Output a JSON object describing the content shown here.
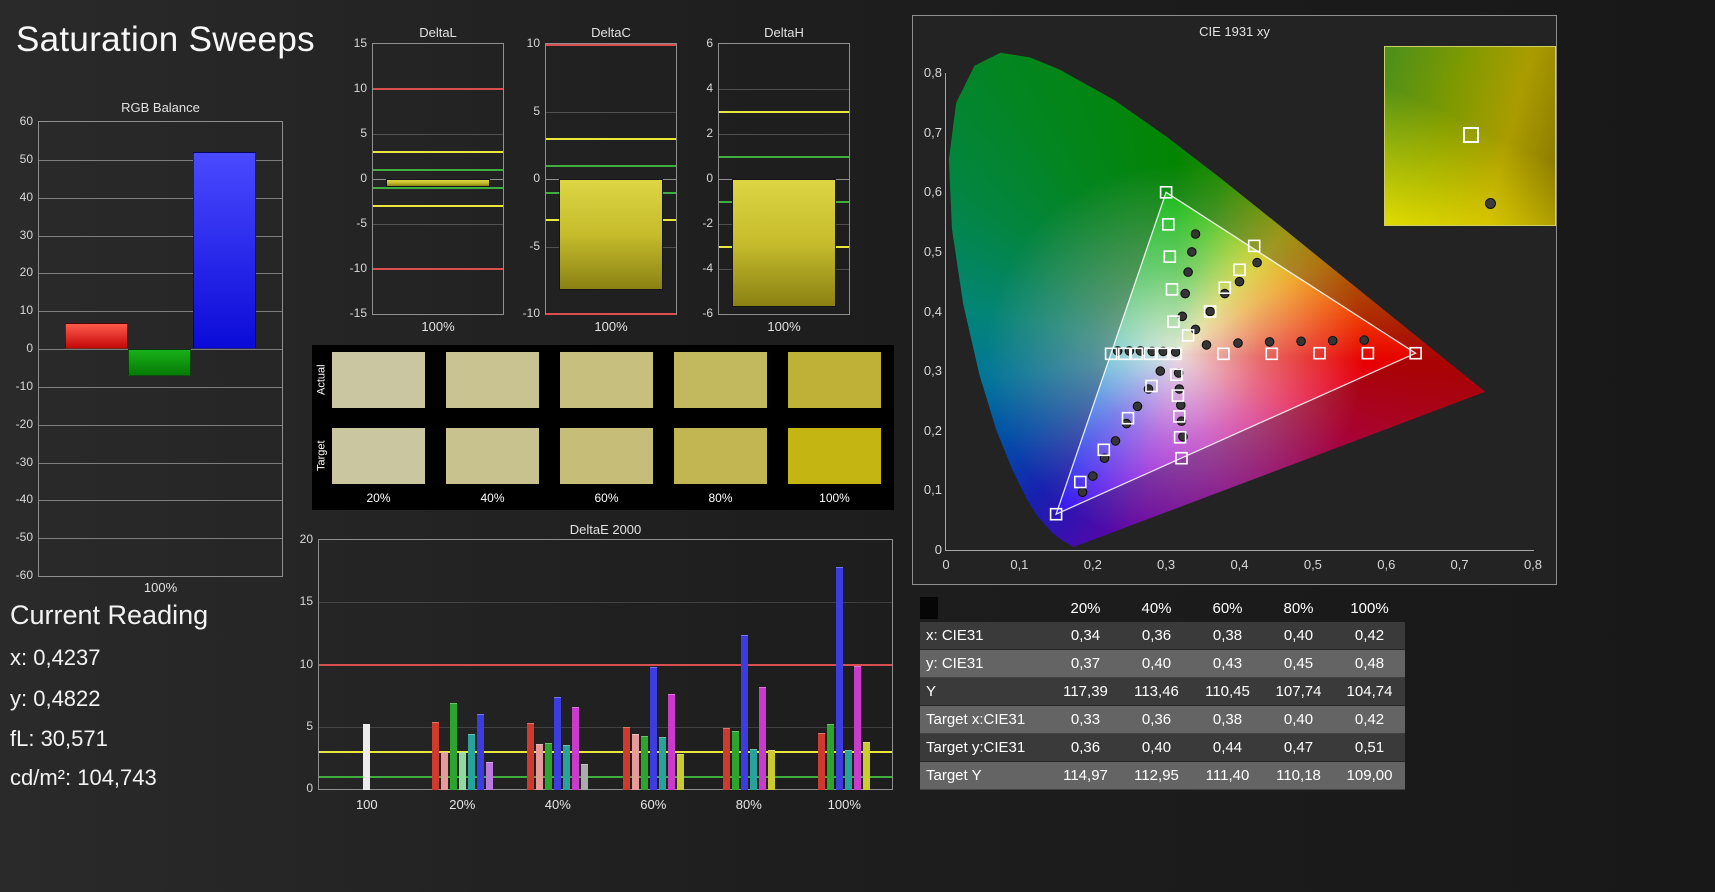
{
  "title": "Saturation Sweeps",
  "current_reading": {
    "heading": "Current Reading",
    "lines": [
      "x: 0,4237",
      "y: 0,4822",
      "fL: 30,571",
      "cd/m²: 104,743"
    ]
  },
  "chart_data": [
    {
      "id": "rgb-balance",
      "type": "bar",
      "title": "RGB Balance",
      "xlabel": "100%",
      "ylim": [
        -60,
        60
      ],
      "ytick_step": 10,
      "categories": [
        "Red",
        "Green",
        "Blue"
      ],
      "values": [
        7,
        -7,
        52
      ],
      "colors": [
        "#e01818",
        "#0f9000",
        "#2222f0"
      ]
    },
    {
      "id": "delta-l",
      "type": "bar",
      "title": "DeltaL",
      "xlabel": "100%",
      "ylim": [
        -15,
        15
      ],
      "yticks": [
        15,
        10,
        5,
        0,
        -5,
        -10,
        -15
      ],
      "categories": [
        "100%"
      ],
      "values": [
        -0.9
      ],
      "bar_color": "#b8c020",
      "ref_lines": [
        {
          "value": 10,
          "color": "#d94f4f"
        },
        {
          "value": -10,
          "color": "#d94f4f"
        },
        {
          "value": 3,
          "color": "#e8e83a"
        },
        {
          "value": -3,
          "color": "#e8e83a"
        },
        {
          "value": 1,
          "color": "#3fae3f"
        },
        {
          "value": -1,
          "color": "#3fae3f"
        }
      ]
    },
    {
      "id": "delta-c",
      "type": "bar",
      "title": "DeltaC",
      "xlabel": "100%",
      "ylim": [
        -10,
        10
      ],
      "yticks": [
        10,
        5,
        0,
        -5,
        -10
      ],
      "categories": [
        "100%"
      ],
      "values": [
        -8.2
      ],
      "bar_color": "#cfc52d",
      "ref_lines": [
        {
          "value": 10,
          "color": "#d94f4f"
        },
        {
          "value": -10,
          "color": "#d94f4f"
        },
        {
          "value": 3,
          "color": "#e8e83a"
        },
        {
          "value": -3,
          "color": "#e8e83a"
        },
        {
          "value": 1,
          "color": "#3fae3f"
        },
        {
          "value": -1,
          "color": "#3fae3f"
        }
      ]
    },
    {
      "id": "delta-h",
      "type": "bar",
      "title": "DeltaH",
      "xlabel": "100%",
      "ylim": [
        -6,
        6
      ],
      "yticks": [
        6,
        4,
        2,
        0,
        -2,
        -4,
        -6
      ],
      "categories": [
        "100%"
      ],
      "values": [
        -5.7
      ],
      "bar_color": "#cfc52d",
      "ref_lines": [
        {
          "value": 3,
          "color": "#e8e83a"
        },
        {
          "value": -3,
          "color": "#e8e83a"
        },
        {
          "value": 1,
          "color": "#3fae3f"
        },
        {
          "value": -1,
          "color": "#3fae3f"
        }
      ]
    },
    {
      "id": "saturation-swatches",
      "type": "table",
      "categories": [
        "20%",
        "40%",
        "60%",
        "80%",
        "100%"
      ],
      "rows": [
        {
          "label": "Actual",
          "colors": [
            "#cbc6a2",
            "#c9c392",
            "#c6bf7e",
            "#c2b95e",
            "#bfb137"
          ]
        },
        {
          "label": "Target",
          "colors": [
            "#cac6a0",
            "#c8c28e",
            "#c5bd78",
            "#c1b652",
            "#c4b512"
          ]
        }
      ]
    },
    {
      "id": "deltae-2000",
      "type": "bar",
      "title": "DeltaE 2000",
      "ylim": [
        0,
        20
      ],
      "yticks": [
        20,
        15,
        10,
        5,
        0
      ],
      "ref_lines": [
        {
          "value": 10,
          "color": "#d94f4f"
        },
        {
          "value": 3,
          "color": "#e8e83a"
        },
        {
          "value": 1,
          "color": "#3fae3f"
        }
      ],
      "groups": [
        {
          "label": "100",
          "bars": [
            {
              "color": "#ececec",
              "value": 5.2
            }
          ]
        },
        {
          "label": "20%",
          "bars": [
            {
              "color": "#cf3a2e",
              "value": 5.4
            },
            {
              "color": "#e79a9a",
              "value": 3.0
            },
            {
              "color": "#2da42d",
              "value": 6.9
            },
            {
              "color": "#93d89e",
              "value": 3.0
            },
            {
              "color": "#27a39b",
              "value": 4.4
            },
            {
              "color": "#3c3cdf",
              "value": 6.0
            },
            {
              "color": "#bb79df",
              "value": 2.2
            }
          ]
        },
        {
          "label": "40%",
          "bars": [
            {
              "color": "#cf3a2e",
              "value": 5.3
            },
            {
              "color": "#e79a9a",
              "value": 3.6
            },
            {
              "color": "#2da42d",
              "value": 3.7
            },
            {
              "color": "#3c3cdf",
              "value": 7.4
            },
            {
              "color": "#27a39b",
              "value": 3.5
            },
            {
              "color": "#cb3bcb",
              "value": 6.6
            },
            {
              "color": "#ababab",
              "value": 2.0
            }
          ]
        },
        {
          "label": "60%",
          "bars": [
            {
              "color": "#cf3a2e",
              "value": 5.0
            },
            {
              "color": "#e79a9a",
              "value": 4.4
            },
            {
              "color": "#2da42d",
              "value": 4.3
            },
            {
              "color": "#3c3cdf",
              "value": 9.8
            },
            {
              "color": "#27a39b",
              "value": 4.2
            },
            {
              "color": "#cb3bcb",
              "value": 7.6
            },
            {
              "color": "#cbcb30",
              "value": 2.8
            }
          ]
        },
        {
          "label": "80%",
          "bars": [
            {
              "color": "#cf3a2e",
              "value": 4.9
            },
            {
              "color": "#2da42d",
              "value": 4.7
            },
            {
              "color": "#3c3cdf",
              "value": 12.4
            },
            {
              "color": "#27a39b",
              "value": 3.2
            },
            {
              "color": "#cb3bcb",
              "value": 8.2
            },
            {
              "color": "#cbcb30",
              "value": 3.1
            }
          ]
        },
        {
          "label": "100%",
          "bars": [
            {
              "color": "#cf3a2e",
              "value": 4.5
            },
            {
              "color": "#2da42d",
              "value": 5.2
            },
            {
              "color": "#3c3cdf",
              "value": 17.8
            },
            {
              "color": "#27a39b",
              "value": 3.1
            },
            {
              "color": "#cb3bcb",
              "value": 9.9
            },
            {
              "color": "#cbcb30",
              "value": 3.8
            }
          ]
        }
      ]
    },
    {
      "id": "cie-1931",
      "type": "scatter",
      "title": "CIE 1931 xy",
      "xlim": [
        0,
        0.8
      ],
      "ylim": [
        0,
        0.8
      ],
      "xtick_labels": [
        "0",
        "0,1",
        "0,2",
        "0,3",
        "0,4",
        "0,5",
        "0,6",
        "0,7",
        "0,8"
      ],
      "ytick_labels": [
        "0",
        "0,1",
        "0,2",
        "0,3",
        "0,4",
        "0,5",
        "0,6",
        "0,7",
        "0,8"
      ],
      "white_point": [
        0.3127,
        0.329
      ],
      "gamut_triangle": {
        "red": [
          0.64,
          0.33
        ],
        "green": [
          0.3,
          0.6
        ],
        "blue": [
          0.15,
          0.06
        ]
      },
      "target_points": [
        [
          0.3127,
          0.329
        ],
        [
          0.378,
          0.329
        ],
        [
          0.444,
          0.329
        ],
        [
          0.509,
          0.33
        ],
        [
          0.575,
          0.33
        ],
        [
          0.64,
          0.33
        ],
        [
          0.31,
          0.383
        ],
        [
          0.308,
          0.437
        ],
        [
          0.305,
          0.492
        ],
        [
          0.303,
          0.546
        ],
        [
          0.3,
          0.6
        ],
        [
          0.28,
          0.275
        ],
        [
          0.248,
          0.221
        ],
        [
          0.215,
          0.168
        ],
        [
          0.183,
          0.114
        ],
        [
          0.15,
          0.06
        ],
        [
          0.295,
          0.329
        ],
        [
          0.278,
          0.329
        ],
        [
          0.26,
          0.329
        ],
        [
          0.243,
          0.329
        ],
        [
          0.225,
          0.329
        ],
        [
          0.314,
          0.294
        ],
        [
          0.316,
          0.259
        ],
        [
          0.318,
          0.224
        ],
        [
          0.319,
          0.189
        ],
        [
          0.321,
          0.154
        ],
        [
          0.33,
          0.36
        ],
        [
          0.36,
          0.4
        ],
        [
          0.38,
          0.44
        ],
        [
          0.4,
          0.47
        ],
        [
          0.42,
          0.51
        ]
      ],
      "measured_points": [
        [
          0.313,
          0.332
        ],
        [
          0.355,
          0.344
        ],
        [
          0.398,
          0.347
        ],
        [
          0.441,
          0.349
        ],
        [
          0.484,
          0.35
        ],
        [
          0.527,
          0.351
        ],
        [
          0.57,
          0.352
        ],
        [
          0.322,
          0.392
        ],
        [
          0.326,
          0.43
        ],
        [
          0.33,
          0.466
        ],
        [
          0.335,
          0.5
        ],
        [
          0.34,
          0.53
        ],
        [
          0.292,
          0.3
        ],
        [
          0.276,
          0.27
        ],
        [
          0.261,
          0.241
        ],
        [
          0.246,
          0.212
        ],
        [
          0.231,
          0.183
        ],
        [
          0.216,
          0.154
        ],
        [
          0.2,
          0.124
        ],
        [
          0.186,
          0.097
        ],
        [
          0.296,
          0.333
        ],
        [
          0.281,
          0.333
        ],
        [
          0.265,
          0.334
        ],
        [
          0.25,
          0.334
        ],
        [
          0.234,
          0.334
        ],
        [
          0.317,
          0.297
        ],
        [
          0.318,
          0.27
        ],
        [
          0.32,
          0.243
        ],
        [
          0.321,
          0.216
        ],
        [
          0.323,
          0.19
        ],
        [
          0.34,
          0.37
        ],
        [
          0.36,
          0.4
        ],
        [
          0.38,
          0.43
        ],
        [
          0.4,
          0.45
        ],
        [
          0.424,
          0.482
        ]
      ]
    }
  ],
  "results_table": {
    "columns": [
      "",
      "20%",
      "40%",
      "60%",
      "80%",
      "100%"
    ],
    "rows": [
      {
        "label": "x: CIE31",
        "values": [
          "0,34",
          "0,36",
          "0,38",
          "0,40",
          "0,42"
        ]
      },
      {
        "label": "y: CIE31",
        "values": [
          "0,37",
          "0,40",
          "0,43",
          "0,45",
          "0,48"
        ]
      },
      {
        "label": "Y",
        "values": [
          "117,39",
          "113,46",
          "110,45",
          "107,74",
          "104,74"
        ]
      },
      {
        "label": "Target x:CIE31",
        "values": [
          "0,33",
          "0,36",
          "0,38",
          "0,40",
          "0,42"
        ]
      },
      {
        "label": "Target y:CIE31",
        "values": [
          "0,36",
          "0,40",
          "0,44",
          "0,47",
          "0,51"
        ]
      },
      {
        "label": "Target Y",
        "values": [
          "114,97",
          "112,95",
          "111,40",
          "110,18",
          "109,00"
        ]
      }
    ]
  }
}
